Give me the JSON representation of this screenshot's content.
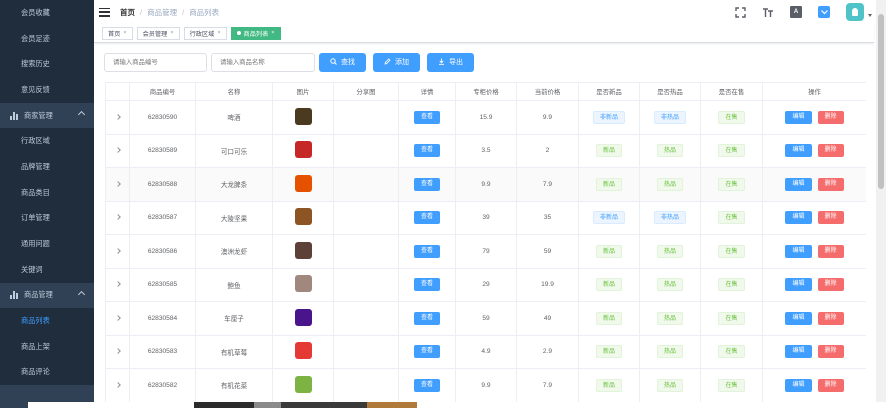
{
  "sidebar": {
    "top_items": [
      {
        "label": "会员收藏"
      },
      {
        "label": "会员足迹"
      },
      {
        "label": "搜索历史"
      },
      {
        "label": "意见反馈"
      }
    ],
    "group1": {
      "label": "商家管理"
    },
    "group1_items": [
      {
        "label": "行政区域"
      },
      {
        "label": "品牌管理"
      },
      {
        "label": "商品类目"
      },
      {
        "label": "订单管理"
      },
      {
        "label": "通用问题"
      },
      {
        "label": "关键词"
      }
    ],
    "group2": {
      "label": "商品管理"
    },
    "group2_items": [
      {
        "label": "商品列表",
        "active": true
      },
      {
        "label": "商品上架"
      },
      {
        "label": "商品评论"
      }
    ]
  },
  "navbar": {
    "breadcrumb": [
      "首页",
      "商品管理",
      "商品列表"
    ],
    "font_icon_label": "A"
  },
  "tags": [
    {
      "label": "首页"
    },
    {
      "label": "会员管理"
    },
    {
      "label": "行政区域"
    },
    {
      "label": "商品列表",
      "active": true
    }
  ],
  "toolbar": {
    "goods_sn_placeholder": "请输入商品编号",
    "goods_name_placeholder": "请输入商品名称",
    "search_label": "查找",
    "add_label": "添加",
    "export_label": "导出"
  },
  "table": {
    "columns": [
      "商品编号",
      "名称",
      "图片",
      "分享图",
      "详情",
      "专柜价格",
      "当前价格",
      "是否新品",
      "是否热品",
      "是否在售",
      "操作"
    ],
    "view_label": "查看",
    "edit_label": "编辑",
    "delete_label": "删除",
    "rows": [
      {
        "sn": "62830590",
        "name": "啤酒",
        "counter_price": "15.9",
        "retail_price": "9.9",
        "is_new": "非新品",
        "is_hot": "非热品",
        "on_sale": "在售",
        "img_color": "#4a3a20"
      },
      {
        "sn": "62830589",
        "name": "可口可乐",
        "counter_price": "3.5",
        "retail_price": "2",
        "is_new": "新品",
        "is_hot": "热品",
        "on_sale": "在售",
        "img_color": "#c62828"
      },
      {
        "sn": "62830588",
        "name": "大龙脾条",
        "counter_price": "9.9",
        "retail_price": "7.9",
        "is_new": "新品",
        "is_hot": "热品",
        "on_sale": "在售",
        "img_color": "#e65100"
      },
      {
        "sn": "62830587",
        "name": "大陵坚果",
        "counter_price": "39",
        "retail_price": "35",
        "is_new": "非新品",
        "is_hot": "非热品",
        "on_sale": "在售",
        "img_color": "#8d5524"
      },
      {
        "sn": "62830586",
        "name": "澳洲龙虾",
        "counter_price": "79",
        "retail_price": "59",
        "is_new": "新品",
        "is_hot": "热品",
        "on_sale": "在售",
        "img_color": "#5d4037"
      },
      {
        "sn": "62830585",
        "name": "鲍鱼",
        "counter_price": "29",
        "retail_price": "19.9",
        "is_new": "新品",
        "is_hot": "热品",
        "on_sale": "在售",
        "img_color": "#a1887f"
      },
      {
        "sn": "62830584",
        "name": "车厘子",
        "counter_price": "59",
        "retail_price": "49",
        "is_new": "新品",
        "is_hot": "热品",
        "on_sale": "在售",
        "img_color": "#4a148c"
      },
      {
        "sn": "62830583",
        "name": "有机草莓",
        "counter_price": "4.9",
        "retail_price": "2.9",
        "is_new": "新品",
        "is_hot": "热品",
        "on_sale": "在售",
        "img_color": "#e53935"
      },
      {
        "sn": "62830582",
        "name": "有机花菜",
        "counter_price": "9.9",
        "retail_price": "7.9",
        "is_new": "新品",
        "is_hot": "热品",
        "on_sale": "在售",
        "img_color": "#7cb342"
      }
    ]
  },
  "colors": {
    "sidebar_bg": "#304156",
    "sidebar_sub_bg": "#1f2d3d",
    "primary": "#409eff",
    "danger": "#f56c6c",
    "success": "#67c23a",
    "tag_active": "#42b983"
  }
}
